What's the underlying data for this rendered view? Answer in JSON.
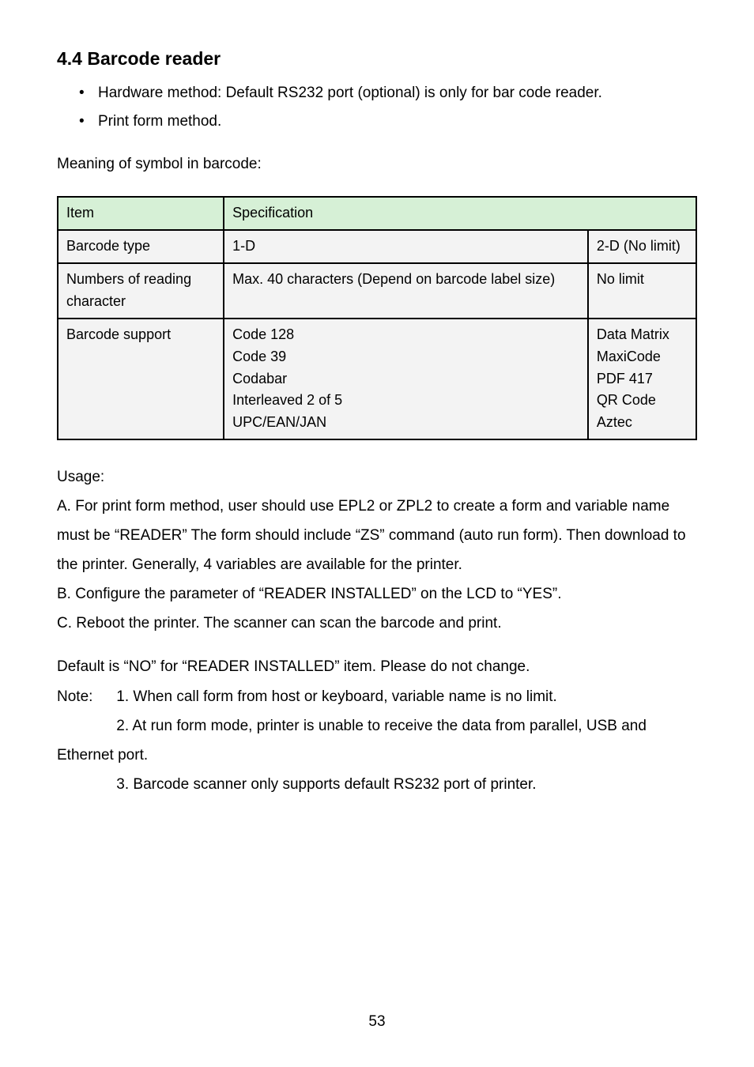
{
  "heading": "4.4 Barcode reader",
  "bullets": [
    "Hardware method: Default RS232 port (optional) is only for bar code reader.",
    "Print form method."
  ],
  "meaning": "Meaning of symbol in barcode:",
  "table": {
    "header": {
      "item": "Item",
      "spec": "Specification"
    },
    "rows": [
      {
        "item": "Barcode type",
        "spec_a": "1-D",
        "spec_b": "2-D (No limit)"
      },
      {
        "item": "Numbers of reading character",
        "spec_a": "Max. 40 characters (Depend on barcode label size)",
        "spec_b": "No limit"
      },
      {
        "item": "Barcode support",
        "spec_a": "Code 128\nCode 39\nCodabar\nInterleaved  2 of 5\nUPC/EAN/JAN",
        "spec_b": "Data Matrix\nMaxiCode\nPDF 417\nQR Code\nAztec"
      }
    ]
  },
  "usage": {
    "title": "Usage:",
    "items": [
      "A. For print form method, user should use EPL2 or ZPL2 to create a form and variable name must be “READER” The form should include “ZS” command (auto run form). Then download to the printer. Generally, 4 variables are available for the printer.",
      "B. Configure the parameter of “READER INSTALLED” on the LCD to “YES”.",
      "C. Reboot the printer. The scanner can scan the barcode and print."
    ]
  },
  "notes": {
    "pre": "Default is “NO” for “READER INSTALLED” item. Please do not change.",
    "label": "Note:",
    "items": [
      "1. When call form from host or keyboard, variable name is no limit.",
      "2. At run form mode, printer is unable to receive the data from parallel, USB and Ethernet port.",
      "3. Barcode scanner only supports default RS232 port of printer."
    ]
  },
  "page": "53"
}
